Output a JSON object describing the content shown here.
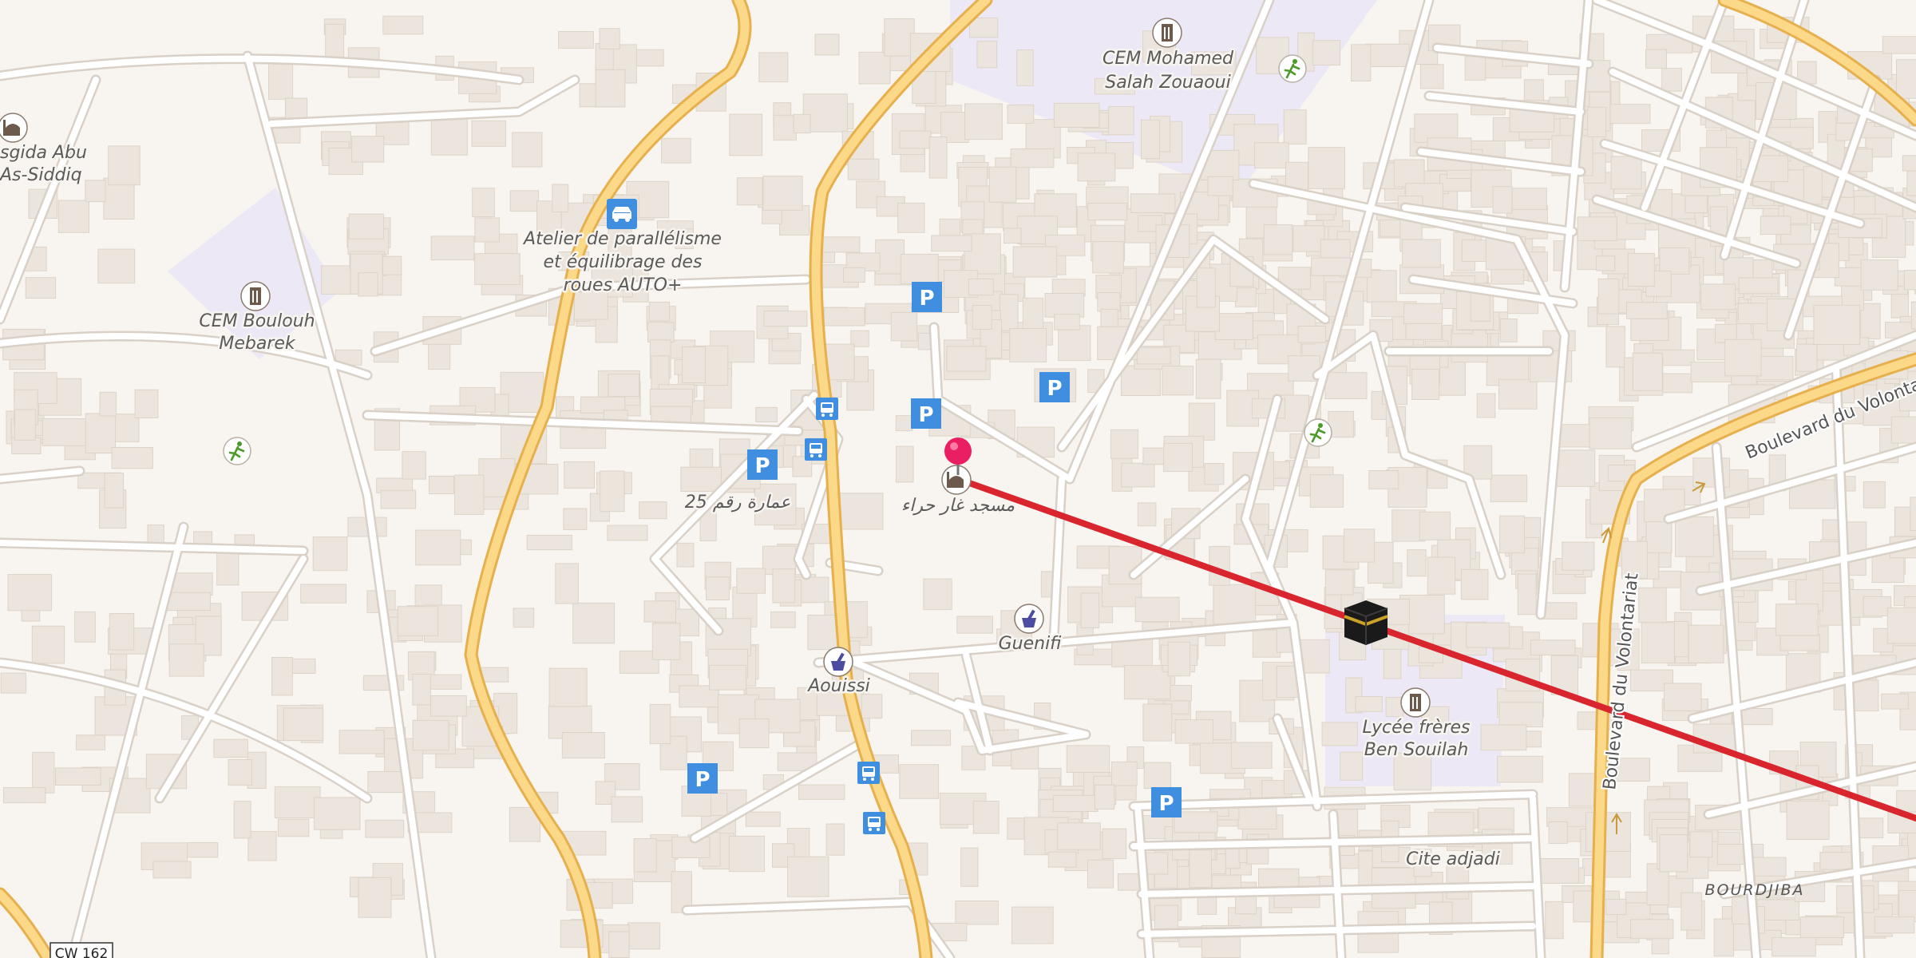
{
  "map": {
    "background_color": "#f8f4f0",
    "road_color": "#ffffff",
    "road_casing_color": "#d9d1c8",
    "main_road_color": "#fcd889",
    "main_road_casing_color": "#e6b04d",
    "building_color": "#ebe5dd",
    "school_area_color": "#ece8f6",
    "route_color": "#d9262e",
    "parking_color": "#3f8ee0"
  },
  "labels": {
    "cem_mohamed_1": "CEM Mohamed",
    "cem_mohamed_2": "Salah Zouaoui",
    "mosque_left_1": "sgida Abu",
    "mosque_left_2": "As-Siddiq",
    "atelier_1": "Atelier de parallélisme",
    "atelier_2": "et équilibrage des",
    "atelier_3": "roues AUTO+",
    "cem_boulouh_1": "CEM Boulouh",
    "cem_boulouh_2": "Mebarek",
    "building_25": "عمارة رقم 25",
    "mosque_main": "مسجد غار حراء",
    "guenifi": "Guenifi",
    "aouissi": "Aouissi",
    "lycee_1": "Lycée frères",
    "lycee_2": "Ben Souilah",
    "cite_adjadi": "Cite adjadi",
    "bourdjiba": "BOURDJIBA",
    "road_ref": "CW 162",
    "boulevard_1": "Boulevard du Volontariat",
    "boulevard_2": "Boulevard du Volontariat",
    "parking_letter": "P"
  },
  "icons": {
    "school": "school-icon",
    "mosque": "mosque-icon",
    "pharmacy": "pharmacy-icon",
    "parking": "parking-icon",
    "bus_stop": "bus-stop-icon",
    "car_repair": "car-repair-icon",
    "sport": "sport-icon",
    "kaaba": "kaaba-icon",
    "pin": "location-pin-icon"
  }
}
